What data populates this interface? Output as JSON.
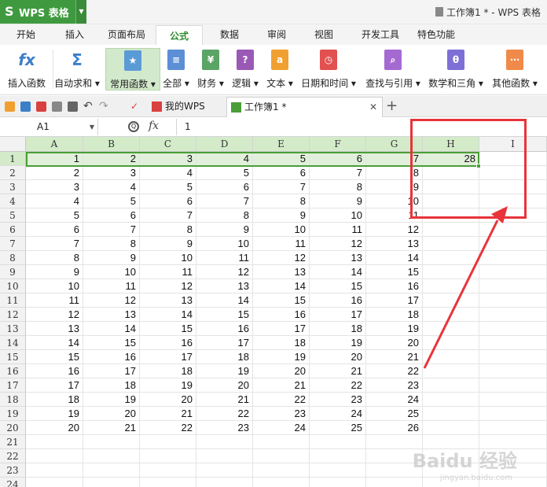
{
  "app": {
    "logo": "S",
    "name": "WPS 表格",
    "doc_title": "工作簿1 * - WPS 表格"
  },
  "menu_tabs": [
    "开始",
    "插入",
    "页面布局",
    "公式",
    "数据",
    "审阅",
    "视图",
    "开发工具",
    "特色功能"
  ],
  "active_menu_tab": "公式",
  "ribbon": [
    {
      "label": "插入函数",
      "icon": "fx-icon",
      "glyph": "fx"
    },
    {
      "label": "自动求和 ▾",
      "icon": "sigma-icon",
      "glyph": "Σ"
    },
    {
      "label": "常用函数 ▾",
      "icon": "star-book-icon",
      "glyph": "★"
    },
    {
      "label": "全部 ▾",
      "icon": "book-icon",
      "glyph": "≡"
    },
    {
      "label": "财务 ▾",
      "icon": "finance-icon",
      "glyph": "¥"
    },
    {
      "label": "逻辑 ▾",
      "icon": "logic-icon",
      "glyph": "?"
    },
    {
      "label": "文本 ▾",
      "icon": "text-icon",
      "glyph": "a"
    },
    {
      "label": "日期和时间 ▾",
      "icon": "clock-icon",
      "glyph": "◷"
    },
    {
      "label": "查找与引用 ▾",
      "icon": "lookup-icon",
      "glyph": "⌕"
    },
    {
      "label": "数学和三角 ▾",
      "icon": "math-icon",
      "glyph": "θ"
    },
    {
      "label": "其他函数 ▾",
      "icon": "more-icon",
      "glyph": "⋯"
    }
  ],
  "ribbon_colors": [
    "#3b7fc9",
    "#3b7fc9",
    "#5b9bd5",
    "#5b8fd6",
    "#5aa466",
    "#9b59b6",
    "#f0a030",
    "#e35050",
    "#a56ad1",
    "#7d6fd6",
    "#f08a4a"
  ],
  "doc_tabs": [
    {
      "label": "我的WPS"
    },
    {
      "label": "工作簿1 *"
    }
  ],
  "formula_bar": {
    "name_box": "A1",
    "fx": "fx",
    "value": "1"
  },
  "sheet": {
    "columns": [
      "A",
      "B",
      "C",
      "D",
      "E",
      "F",
      "G",
      "H",
      "I"
    ],
    "selected_row": 1,
    "rows": [
      [
        "1",
        "2",
        "3",
        "4",
        "5",
        "6",
        "7",
        "28",
        ""
      ],
      [
        "2",
        "3",
        "4",
        "5",
        "6",
        "7",
        "8",
        "",
        ""
      ],
      [
        "3",
        "4",
        "5",
        "6",
        "7",
        "8",
        "9",
        "",
        ""
      ],
      [
        "4",
        "5",
        "6",
        "7",
        "8",
        "9",
        "10",
        "",
        ""
      ],
      [
        "5",
        "6",
        "7",
        "8",
        "9",
        "10",
        "11",
        "",
        ""
      ],
      [
        "6",
        "7",
        "8",
        "9",
        "10",
        "11",
        "12",
        "",
        ""
      ],
      [
        "7",
        "8",
        "9",
        "10",
        "11",
        "12",
        "13",
        "",
        ""
      ],
      [
        "8",
        "9",
        "10",
        "11",
        "12",
        "13",
        "14",
        "",
        ""
      ],
      [
        "9",
        "10",
        "11",
        "12",
        "13",
        "14",
        "15",
        "",
        ""
      ],
      [
        "10",
        "11",
        "12",
        "13",
        "14",
        "15",
        "16",
        "",
        ""
      ],
      [
        "11",
        "12",
        "13",
        "14",
        "15",
        "16",
        "17",
        "",
        ""
      ],
      [
        "12",
        "13",
        "14",
        "15",
        "16",
        "17",
        "18",
        "",
        ""
      ],
      [
        "13",
        "14",
        "15",
        "16",
        "17",
        "18",
        "19",
        "",
        ""
      ],
      [
        "14",
        "15",
        "16",
        "17",
        "18",
        "19",
        "20",
        "",
        ""
      ],
      [
        "15",
        "16",
        "17",
        "18",
        "19",
        "20",
        "21",
        "",
        ""
      ],
      [
        "16",
        "17",
        "18",
        "19",
        "20",
        "21",
        "22",
        "",
        ""
      ],
      [
        "17",
        "18",
        "19",
        "20",
        "21",
        "22",
        "23",
        "",
        ""
      ],
      [
        "18",
        "19",
        "20",
        "21",
        "22",
        "23",
        "24",
        "",
        ""
      ],
      [
        "19",
        "20",
        "21",
        "22",
        "23",
        "24",
        "25",
        "",
        ""
      ],
      [
        "20",
        "21",
        "22",
        "23",
        "24",
        "25",
        "26",
        "",
        ""
      ],
      [
        "",
        "",
        "",
        "",
        "",
        "",
        "",
        "",
        ""
      ],
      [
        "",
        "",
        "",
        "",
        "",
        "",
        "",
        "",
        ""
      ],
      [
        "",
        "",
        "",
        "",
        "",
        "",
        "",
        "",
        ""
      ],
      [
        "",
        "",
        "",
        "",
        "",
        "",
        "",
        "",
        ""
      ]
    ]
  },
  "watermark": {
    "text": "Baidu 经验",
    "sub": "jingyan.baidu.com"
  },
  "annotation_color": "#e8343a"
}
